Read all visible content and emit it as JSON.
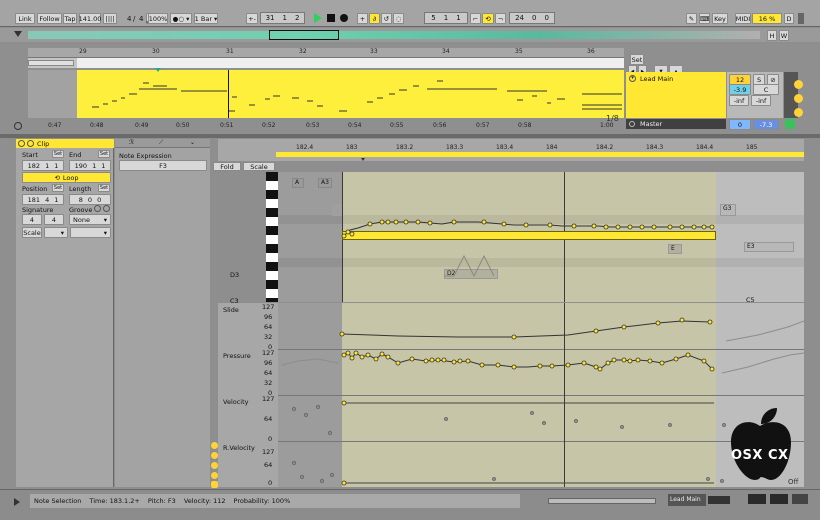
{
  "transport": {
    "link": "Link",
    "follow": "Follow",
    "tap": "Tap",
    "tempo": "141.00",
    "tempo_pulse": "||||",
    "meter_num": "4",
    "meter_den": "4",
    "zoom": "100%",
    "metronome": "●○ ▾",
    "quantize": "1 Bar ▾",
    "pos1": "31",
    "pos2": "1",
    "pos3": "2",
    "loop1": "5",
    "loop2": "1",
    "loop3": "1",
    "len1": "24",
    "len2": "0",
    "len3": "0",
    "key": "Key",
    "midi": "MIDI",
    "cpu": "16 %",
    "d": "D"
  },
  "arrangement": {
    "ruler": [
      "29",
      "30",
      "31",
      "32",
      "33",
      "34",
      "35",
      "36"
    ],
    "time_ruler": [
      "0:47",
      "0:48",
      "0:49",
      "0:50",
      "0:51",
      "0:52",
      "0:53",
      "0:54",
      "0:55",
      "0:56",
      "0:57",
      "0:58",
      "1:00"
    ],
    "set_label": "Set",
    "page": "1/8",
    "track_name": "Lead Main",
    "track_num": "12",
    "track_s": "S",
    "vol": "-3.9",
    "pan": "C",
    "send_a": "-inf",
    "send_b": "-inf",
    "master_name": "Master",
    "master_num": "0",
    "master_vol": "-7.3"
  },
  "clip": {
    "title": "Clip",
    "start_label": "Start",
    "end_label": "End",
    "set": "Set",
    "start": [
      "182",
      "1",
      "1"
    ],
    "end": [
      "190",
      "1",
      "1"
    ],
    "loop": "Loop",
    "position_label": "Position",
    "length_label": "Length",
    "position": [
      "181",
      "4",
      "1"
    ],
    "length": [
      "8",
      "0",
      "0"
    ],
    "signature_label": "Signature",
    "groove_label": "Groove",
    "sig_num": "4",
    "sig_den": "4",
    "groove": "None",
    "scale": "Scale"
  },
  "expression": {
    "title": "Note Expression",
    "note": "F3",
    "fold": "Fold",
    "scale": "Scale"
  },
  "editor": {
    "ruler": [
      "182.4",
      "183",
      "183.2",
      "183.3",
      "183.4",
      "184",
      "184.2",
      "184.3",
      "184.4",
      "185"
    ],
    "note_labels": {
      "a": "A",
      "a3": "A3",
      "d3": "D3",
      "c3": "C3",
      "d2": "D2",
      "g3": "G3",
      "e3": "E3",
      "c5": "C5",
      "e": "E"
    },
    "lanes": [
      {
        "name": "Slide",
        "ticks": [
          "127",
          "96",
          "64",
          "32",
          "0"
        ]
      },
      {
        "name": "Pressure",
        "ticks": [
          "127",
          "96",
          "64",
          "32",
          "0"
        ]
      },
      {
        "name": "Velocity",
        "ticks": [
          "127",
          "64",
          "0"
        ]
      },
      {
        "name": "R.Velocity",
        "ticks": [
          "127",
          "64",
          "0"
        ]
      }
    ]
  },
  "status": {
    "note_selection": "Note Selection",
    "time": "Time: 183.1.2+",
    "pitch": "Pitch: F3",
    "velocity": "Velocity: 112",
    "probability": "Probability: 100%",
    "track": "Lead Main",
    "off": "Off"
  },
  "watermark": {
    "text": "OSX CX"
  },
  "colors": {
    "accent": "#ffe733",
    "track_blue": "#6fd0e6",
    "master_blue": "#7fb8ff"
  }
}
